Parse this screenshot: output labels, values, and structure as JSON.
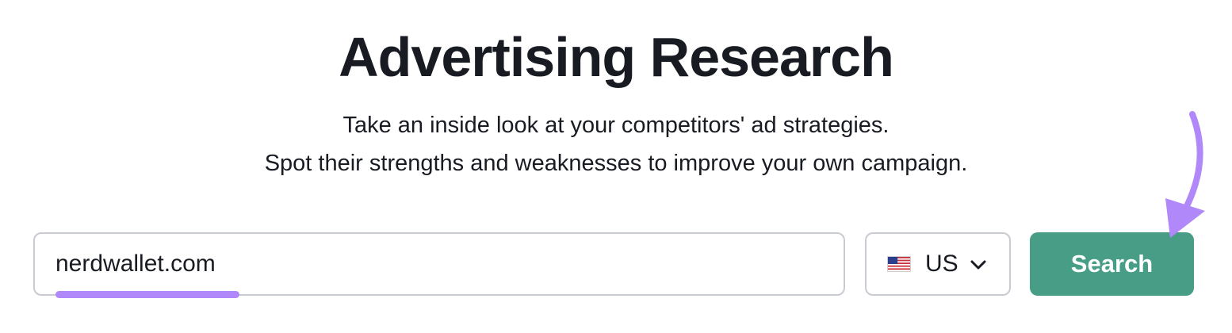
{
  "page": {
    "title": "Advertising Research",
    "subtitle_line1": "Take an inside look at your competitors' ad strategies.",
    "subtitle_line2": "Spot their strengths and weaknesses to improve your own campaign."
  },
  "search": {
    "domain_value": "nerdwallet.com",
    "region": {
      "selected": "US",
      "flag_icon": "us-flag-icon"
    },
    "button_label": "Search"
  },
  "colors": {
    "title_text": "#191b23",
    "button_bg": "#479d86",
    "highlight": "#b088f9",
    "border": "#c9cbd2"
  },
  "annotations": {
    "arrow_icon": "arrow-pointing-icon",
    "underline": "highlight-underline"
  }
}
